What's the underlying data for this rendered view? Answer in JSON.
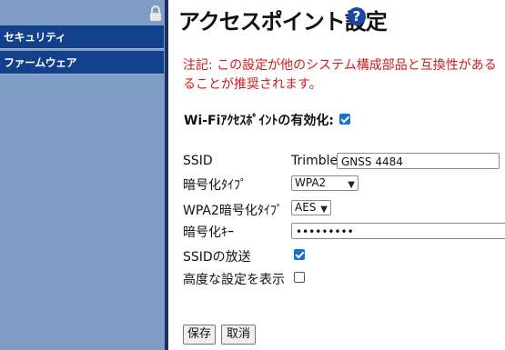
{
  "sidebar": {
    "items": [
      {
        "label": "セキュリティ"
      },
      {
        "label": "ファームウェア"
      }
    ]
  },
  "page": {
    "title": "アクセスポイント設定",
    "help_icon": "?"
  },
  "note": {
    "line1": "注記: この設定が他のシステム構成部品と互換性がある",
    "line2": "ることが推奨されます。"
  },
  "form": {
    "enable_label": "Wi-Fiｱｸｾｽﾎﾟｲﾝﾄの有効化:",
    "enable_checked": true,
    "ssid_label": "SSID",
    "ssid_prefix": "Trimble",
    "ssid_value": "GNSS 4484",
    "encryption_type_label": "暗号化ﾀｲﾌﾟ",
    "encryption_type_value": "WPA2",
    "wpa2_encryption_type_label": "WPA2暗号化ﾀｲﾌﾟ",
    "wpa2_encryption_type_value": "AES",
    "encryption_key_label": "暗号化ｷｰ",
    "encryption_key_value": "•••••••••",
    "broadcast_ssid_label": "SSIDの放送",
    "broadcast_ssid_checked": true,
    "show_advanced_label": "高度な設定を表示",
    "show_advanced_checked": false
  },
  "buttons": {
    "save": "保存",
    "cancel": "取消"
  },
  "colors": {
    "sidebar_bg": "#7e9cc4",
    "sidebar_item_bg": "#12408a",
    "note_red": "#d11b1b",
    "checkbox_blue": "#1673d6"
  }
}
